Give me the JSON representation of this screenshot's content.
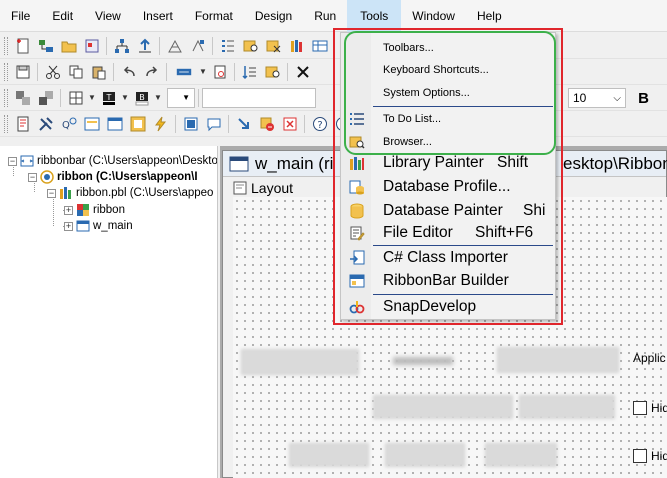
{
  "menubar": {
    "items": [
      "File",
      "Edit",
      "View",
      "Insert",
      "Format",
      "Design",
      "Run",
      "Tools",
      "Window",
      "Help"
    ],
    "active": "Tools"
  },
  "toolbar3": {
    "font_size": "10",
    "bold_label": "B"
  },
  "tree": {
    "nodes": [
      {
        "text": "ribbonbar (C:\\Users\\appeon\\Deskto",
        "bold": false,
        "icon": "workspace-icon"
      },
      {
        "text": "ribbon (C:\\Users\\appeon\\I",
        "bold": true,
        "icon": "target-icon"
      },
      {
        "text": "ribbon.pbl (C:\\Users\\appeo",
        "bold": false,
        "icon": "library-icon"
      },
      {
        "text": "ribbon",
        "bold": false,
        "icon": "application-icon"
      },
      {
        "text": "w_main",
        "bold": false,
        "icon": "window-icon"
      }
    ]
  },
  "workspace": {
    "window_title": "w_main (ri",
    "window_title_tail": "esktop\\Ribbon",
    "layout_tab": "Layout",
    "appl_label": "Applic",
    "hide_label_1": "Hid",
    "hide_label_2": "Hid"
  },
  "tools_menu": {
    "items": [
      {
        "label": "Toolbars...",
        "icon": "",
        "size": "small"
      },
      {
        "label": "Keyboard Shortcuts...",
        "icon": "",
        "size": "small"
      },
      {
        "label": "System Options...",
        "icon": "",
        "size": "small"
      },
      {
        "label": "To Do List...",
        "icon": "todo-list-icon",
        "size": "small"
      },
      {
        "label": "Browser...",
        "icon": "browser-icon",
        "size": "small"
      },
      {
        "label": "Library Painter",
        "shortcut": "Shift",
        "icon": "library-painter-icon",
        "size": "big"
      },
      {
        "label": "Database Profile...",
        "icon": "database-profile-icon",
        "size": "big"
      },
      {
        "label": "Database Painter",
        "shortcut": "Shi",
        "icon": "database-painter-icon",
        "size": "big"
      },
      {
        "label": "File Editor",
        "shortcut": "Shift+F6",
        "icon": "file-editor-icon",
        "size": "big"
      },
      {
        "label": "C# Class Importer",
        "icon": "class-importer-icon",
        "size": "big"
      },
      {
        "label": "RibbonBar Builder",
        "icon": "ribbonbar-builder-icon",
        "size": "big"
      },
      {
        "label": "SnapDevelop",
        "icon": "snapdevelop-icon",
        "size": "big"
      }
    ]
  },
  "colors": {
    "annotation_red": "#e0262c",
    "annotation_green": "#3cb04a",
    "menu_active": "#cce4f7",
    "separator": "#2b4a8a"
  }
}
